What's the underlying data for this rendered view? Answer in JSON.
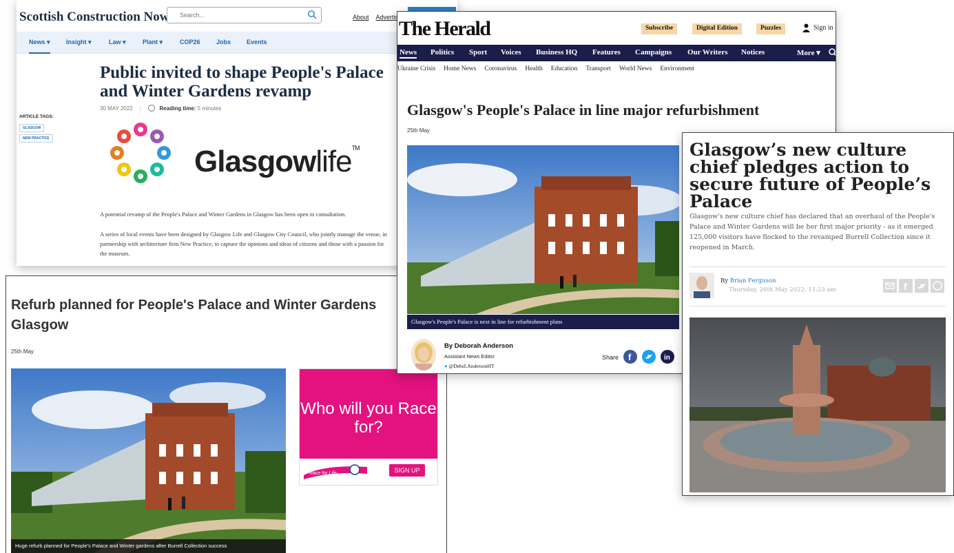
{
  "colors": {
    "scn_navy": "#1d2d44",
    "scn_blue": "#2066a8",
    "herald_navy": "#1b1e4b",
    "herald_pill": "#f6d7a7",
    "ad_pink": "#e3127f",
    "culture_link": "#2a7cc0"
  },
  "scn": {
    "logo": "Scottish Construction Now",
    "search_placeholder": "Search...",
    "links": [
      "About",
      "Advertis"
    ],
    "nav": [
      "News ▾",
      "Insight ▾",
      "Law ▾",
      "Plant ▾",
      "COP26",
      "Jobs",
      "Events"
    ],
    "title": "Public invited to shape People's Palace and Winter Gardens revamp",
    "date": "30 MAY 2022",
    "reading_label": "Reading time:",
    "reading_value": "5 minutes",
    "tags_label": "ARTICLE TAGS:",
    "tags": [
      "GLASGOW",
      "NEW PRACTICE"
    ],
    "logo_image": {
      "word1": "Glasgow",
      "word2": "life",
      "tm": "TM"
    },
    "paragraphs": [
      "A potential revamp of the People's Palace and Winter Gardens in Glasgow has been open to consultation.",
      "A series of local events have been designed by Glasgow Life and Glasgow City Council, who jointly manage the venue, in partnership with architecture firm New Practice, to capture the opinions and ideas of citizens and those with a passion for the museum."
    ]
  },
  "refurb": {
    "title": "Refurb planned for People's Palace and Winter Gardens Glasgow",
    "date": "25th May",
    "caption": "Huge refurb planned for People's Palace and Winter gardens after Burrell Collection success",
    "ad": {
      "headline": "Who will you Race for?",
      "brand": "Race for Life",
      "cta": "SIGN UP"
    }
  },
  "herald": {
    "masthead": "The Herald",
    "pills": [
      "Subscribe",
      "Digital Edition",
      "Puzzles"
    ],
    "signin": "Sign in",
    "nav": [
      "News",
      "Politics",
      "Sport",
      "Voices",
      "Business HQ",
      "Features",
      "Campaigns",
      "Our Writers",
      "Notices",
      "More ▾"
    ],
    "subnav": [
      "Ukraine Crisis",
      "Home News",
      "Coronavirus",
      "Health",
      "Education",
      "Transport",
      "World News",
      "Environment"
    ],
    "title": "Glasgow's People's Palace in line major refurbishment",
    "date": "25th May",
    "caption": "Glasgow's People's Palace is next in line for refurbishment plans",
    "author": "By Deborah Anderson",
    "role": "Assistant News Editor",
    "twitter": "@DebsLAndersonHT",
    "share_label": "Share"
  },
  "culture": {
    "title": "Glasgow’s new culture chief pledges action to secure future of People’s Palace",
    "lede": "Glasgow's new culture chief has declared that an overhaul of the People's Palace and Winter Gardens will be her first major priority - as it emerged 125,000 visitors have flocked to the revamped Burrell Collection since it reopened in March.",
    "by": "By",
    "author": "Brian Ferguson",
    "timestamp": "Thursday, 26th May 2022, 11:23 am"
  }
}
